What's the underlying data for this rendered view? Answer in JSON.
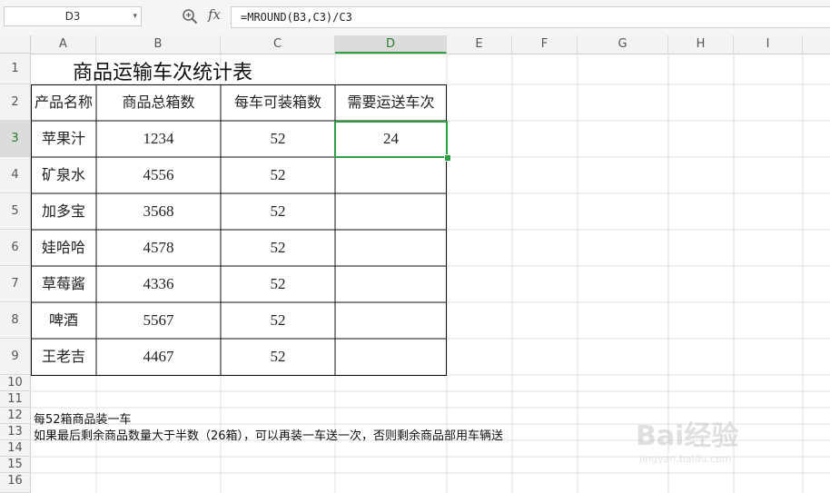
{
  "formula_bar": {
    "name_box": "D3",
    "fx_label": "fx",
    "formula": "=MROUND(B3,C3)/C3"
  },
  "columns": [
    "A",
    "B",
    "C",
    "D",
    "E",
    "F",
    "G",
    "H",
    "I"
  ],
  "rows": [
    "1",
    "2",
    "3",
    "4",
    "5",
    "6",
    "7",
    "8",
    "9",
    "10",
    "11",
    "12",
    "13",
    "14",
    "15",
    "16"
  ],
  "selected_cell": {
    "column": "D",
    "row": "3"
  },
  "sheet": {
    "title": "商品运输车次统计表",
    "headers": [
      "产品名称",
      "商品总箱数",
      "每车可装箱数",
      "需要运送车次"
    ],
    "table_rows": [
      {
        "name": "苹果汁",
        "total": "1234",
        "per_truck": "52",
        "trips": "24"
      },
      {
        "name": "矿泉水",
        "total": "4556",
        "per_truck": "52",
        "trips": ""
      },
      {
        "name": "加多宝",
        "total": "3568",
        "per_truck": "52",
        "trips": ""
      },
      {
        "name": "娃哈哈",
        "total": "4578",
        "per_truck": "52",
        "trips": ""
      },
      {
        "name": "草莓酱",
        "total": "4336",
        "per_truck": "52",
        "trips": ""
      },
      {
        "name": "啤酒",
        "total": "5567",
        "per_truck": "52",
        "trips": ""
      },
      {
        "name": "王老吉",
        "total": "4467",
        "per_truck": "52",
        "trips": ""
      }
    ],
    "note1": "每52箱商品装一车",
    "note2": "如果最后剩余商品数量大于半数（26箱），可以再装一车送一次，否则剩余商品部用车辆送"
  },
  "watermark": {
    "main": "Bai经验",
    "sub": "jingyan.baidu.com"
  },
  "colors": {
    "selection": "#2e9e44"
  }
}
